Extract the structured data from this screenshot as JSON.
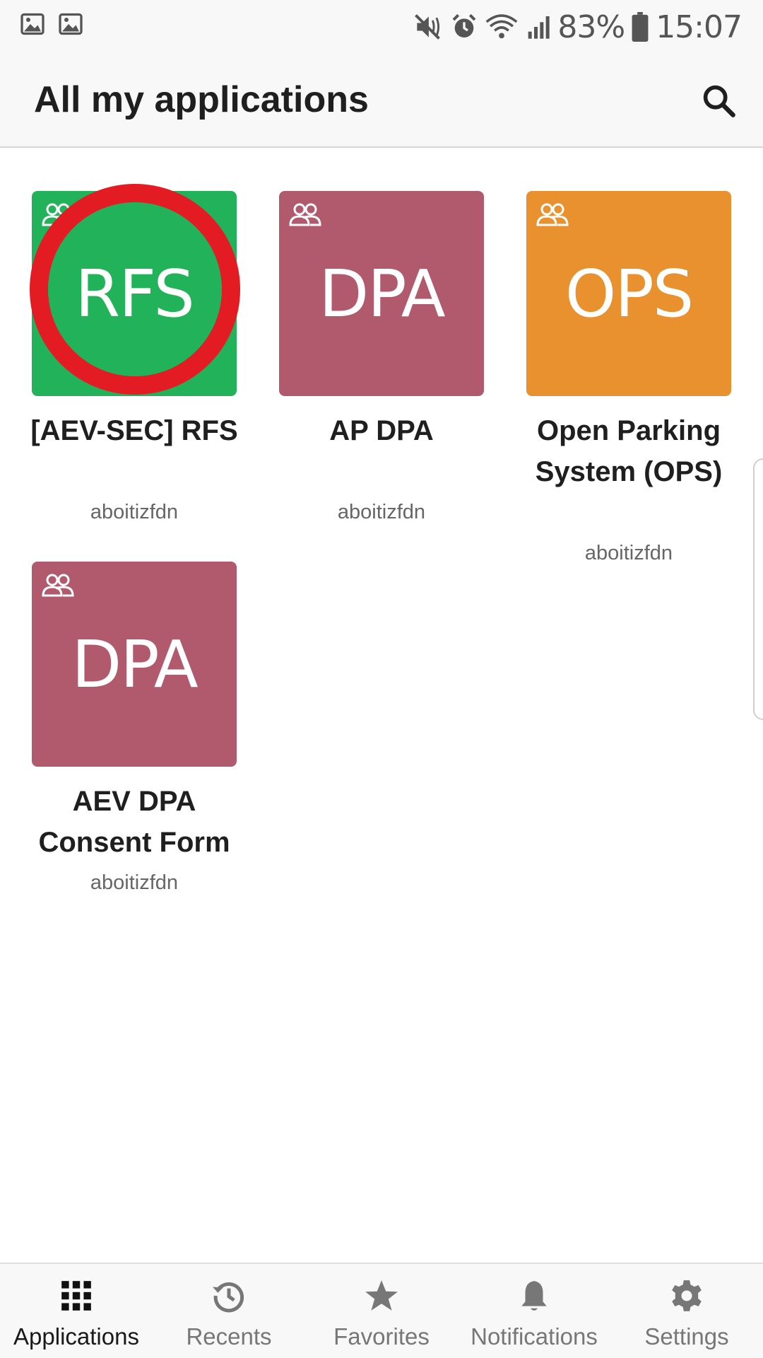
{
  "status_bar": {
    "battery": "83%",
    "time": "15:07",
    "icons": [
      "image-icon",
      "image-icon",
      "mute-icon",
      "alarm-icon",
      "wifi-icon",
      "signal-icon",
      "battery-icon"
    ]
  },
  "header": {
    "title": "All my applications",
    "search_icon": "search-icon"
  },
  "apps": [
    {
      "abbr": "RFS",
      "name": "[AEV-SEC] RFS",
      "owner": "aboitizfdn",
      "color": "#22b35a",
      "highlighted": true
    },
    {
      "abbr": "DPA",
      "name": "AP DPA",
      "owner": "aboitizfdn",
      "color": "#b15a6e"
    },
    {
      "abbr": "OPS",
      "name": "Open Parking System (OPS)",
      "owner": "aboitizfdn",
      "color": "#e8912e"
    },
    {
      "abbr": "DPA",
      "name": "AEV DPA Consent Form",
      "owner": "aboitizfdn",
      "color": "#b15a6e"
    }
  ],
  "bottom_nav": [
    {
      "label": "Applications",
      "icon": "grid-icon",
      "active": true
    },
    {
      "label": "Recents",
      "icon": "history-icon"
    },
    {
      "label": "Favorites",
      "icon": "star-icon"
    },
    {
      "label": "Notifications",
      "icon": "bell-icon"
    },
    {
      "label": "Settings",
      "icon": "gear-icon"
    }
  ],
  "colors": {
    "highlight_ring": "#e31b23",
    "header_bg": "#f8f8f8"
  }
}
